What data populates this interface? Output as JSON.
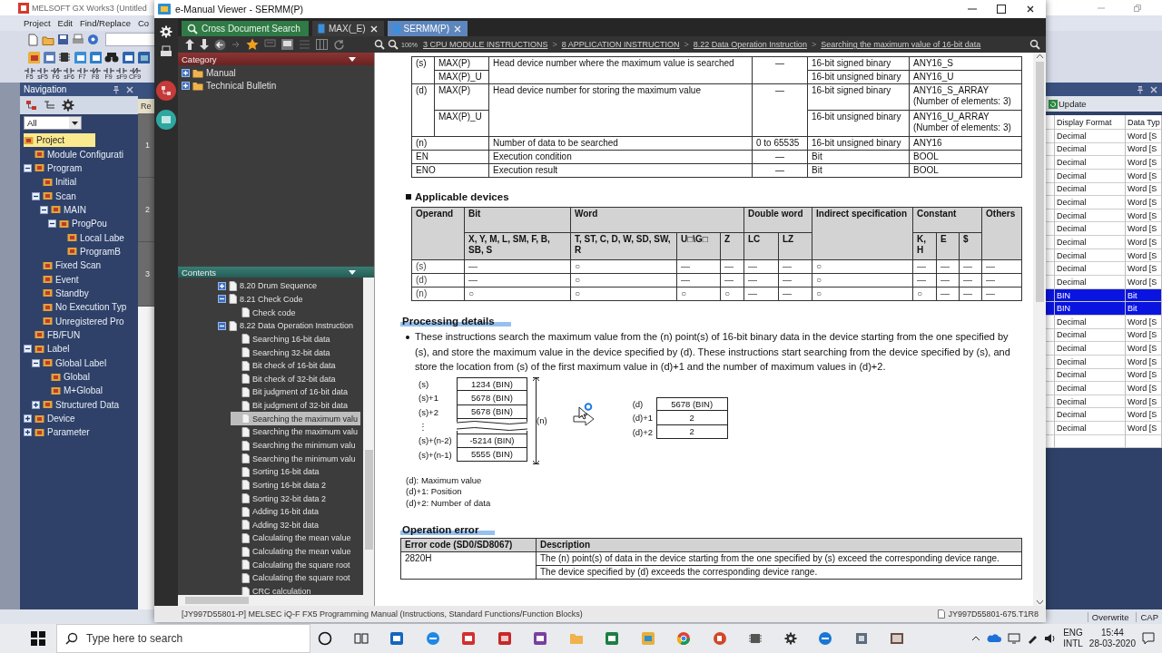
{
  "back_window": {
    "title": "MELSOFT GX Works3 (Untitled",
    "menu": [
      "Project",
      "Edit",
      "Find/Replace",
      "Co"
    ],
    "ladder_keys": [
      "F5",
      "sF5",
      "F6",
      "sF6",
      "F7",
      "F8",
      "F9",
      "sF9",
      "CF9"
    ],
    "navigation": {
      "title": "Navigation",
      "filter": "All",
      "tree": [
        {
          "label": "Project",
          "selected": true,
          "children": [
            {
              "label": "Module Configurati",
              "selected": false
            },
            {
              "label": "Program",
              "selected": false,
              "expanded": true,
              "children": [
                {
                  "label": "Initial",
                  "selected": false
                },
                {
                  "label": "Scan",
                  "selected": false,
                  "expanded": true,
                  "children": [
                    {
                      "label": "MAIN",
                      "selected": false,
                      "expanded": true,
                      "children": [
                        {
                          "label": "ProgPou",
                          "selected": false,
                          "expanded": true,
                          "children": [
                            {
                              "label": "Local Labe",
                              "selected": false
                            },
                            {
                              "label": "ProgramB",
                              "selected": false
                            }
                          ]
                        }
                      ]
                    }
                  ]
                },
                {
                  "label": "Fixed Scan",
                  "selected": false
                },
                {
                  "label": "Event",
                  "selected": false
                },
                {
                  "label": "Standby",
                  "selected": false
                },
                {
                  "label": "No Execution Typ",
                  "selected": false
                },
                {
                  "label": "Unregistered Pro",
                  "selected": false
                }
              ]
            },
            {
              "label": "FB/FUN",
              "selected": false
            },
            {
              "label": "Label",
              "selected": false,
              "expanded": true,
              "children": [
                {
                  "label": "Global Label",
                  "selected": false,
                  "expanded": true,
                  "children": [
                    {
                      "label": "Global",
                      "selected": false
                    },
                    {
                      "label": "M+Global",
                      "selected": false
                    }
                  ]
                },
                {
                  "label": "Structured Data",
                  "selected": false,
                  "expanded": false
                }
              ]
            },
            {
              "label": "Device",
              "selected": false,
              "expanded": false
            },
            {
              "label": "Parameter",
              "selected": false,
              "expanded": false
            }
          ]
        }
      ]
    },
    "editor": {
      "tab": "Re",
      "line_numbers": [
        "1",
        "2",
        "3"
      ]
    },
    "watch": {
      "toolbar_button": "Update",
      "columns": [
        "Display Format",
        "Data Typ"
      ],
      "rows": [
        {
          "display_format": "Decimal",
          "data_type": "Word [S",
          "selected": false
        },
        {
          "display_format": "Decimal",
          "data_type": "Word [S",
          "selected": false
        },
        {
          "display_format": "Decimal",
          "data_type": "Word [S",
          "selected": false
        },
        {
          "display_format": "Decimal",
          "data_type": "Word [S",
          "selected": false
        },
        {
          "display_format": "Decimal",
          "data_type": "Word [S",
          "selected": false
        },
        {
          "display_format": "Decimal",
          "data_type": "Word [S",
          "selected": false
        },
        {
          "display_format": "Decimal",
          "data_type": "Word [S",
          "selected": false
        },
        {
          "display_format": "Decimal",
          "data_type": "Word [S",
          "selected": false
        },
        {
          "display_format": "Decimal",
          "data_type": "Word [S",
          "selected": false
        },
        {
          "display_format": "Decimal",
          "data_type": "Word [S",
          "selected": false
        },
        {
          "display_format": "Decimal",
          "data_type": "Word [S",
          "selected": false
        },
        {
          "display_format": "Decimal",
          "data_type": "Word [S",
          "selected": false
        },
        {
          "display_format": "BIN",
          "data_type": "Bit",
          "selected": true
        },
        {
          "display_format": "BIN",
          "data_type": "Bit",
          "selected": true
        },
        {
          "display_format": "Decimal",
          "data_type": "Word [S",
          "selected": false
        },
        {
          "display_format": "Decimal",
          "data_type": "Word [S",
          "selected": false
        },
        {
          "display_format": "Decimal",
          "data_type": "Word [S",
          "selected": false
        },
        {
          "display_format": "Decimal",
          "data_type": "Word [S",
          "selected": false
        },
        {
          "display_format": "Decimal",
          "data_type": "Word [S",
          "selected": false
        },
        {
          "display_format": "Decimal",
          "data_type": "Word [S",
          "selected": false
        },
        {
          "display_format": "Decimal",
          "data_type": "Word [S",
          "selected": false
        },
        {
          "display_format": "Decimal",
          "data_type": "Word [S",
          "selected": false
        },
        {
          "display_format": "Decimal",
          "data_type": "Word [S",
          "selected": false
        }
      ]
    },
    "status_bar": [
      "Overwrite",
      "CAP"
    ]
  },
  "manual_viewer": {
    "title": "e-Manual Viewer - SERMM(P)",
    "tabs": [
      {
        "label": "Cross Document Search",
        "kind": "search",
        "selected": false,
        "closable": false
      },
      {
        "label": "MAX(_E)",
        "kind": "document",
        "selected": false,
        "closable": true
      },
      {
        "label": "SERMM(P)",
        "kind": "document",
        "selected": true,
        "closable": true
      }
    ],
    "zoom": "100%",
    "breadcrumb": {
      "separator": ">",
      "items": [
        "3 CPU MODULE INSTRUCTIONS",
        "8 APPLICATION INSTRUCTION",
        "8.22 Data Operation Instruction",
        "Searching the maximum value of 16-bit data"
      ]
    },
    "category": {
      "title": "Category",
      "tree": [
        {
          "label": "Manual",
          "expanded": false
        },
        {
          "label": "Technical Bulletin",
          "expanded": false
        }
      ]
    },
    "contents": {
      "title": "Contents",
      "tree": [
        {
          "label": "8.20 Drum Sequence",
          "expanded": false,
          "selected": false
        },
        {
          "label": "8.21 Check Code",
          "expanded": true,
          "selected": false,
          "children": [
            {
              "label": "Check code",
              "selected": false
            }
          ]
        },
        {
          "label": "8.22 Data Operation Instruction",
          "expanded": true,
          "selected": false,
          "children": [
            {
              "label": "Searching 16-bit data",
              "selected": false
            },
            {
              "label": "Searching 32-bit data",
              "selected": false
            },
            {
              "label": "Bit check of 16-bit data",
              "selected": false
            },
            {
              "label": "Bit check of 32-bit data",
              "selected": false
            },
            {
              "label": "Bit judgment of 16-bit data",
              "selected": false
            },
            {
              "label": "Bit judgment of 32-bit data",
              "selected": false
            },
            {
              "label": "Searching the maximum valu",
              "selected": true
            },
            {
              "label": "Searching the maximum valu",
              "selected": false
            },
            {
              "label": "Searching the minimum valu",
              "selected": false
            },
            {
              "label": "Searching the minimum valu",
              "selected": false
            },
            {
              "label": "Sorting 16-bit data",
              "selected": false
            },
            {
              "label": "Sorting 16-bit data 2",
              "selected": false
            },
            {
              "label": "Sorting 32-bit data 2",
              "selected": false
            },
            {
              "label": "Adding 16-bit data",
              "selected": false
            },
            {
              "label": "Adding 32-bit data",
              "selected": false
            },
            {
              "label": "Calculating the mean value",
              "selected": false
            },
            {
              "label": "Calculating the mean value",
              "selected": false
            },
            {
              "label": "Calculating the square root",
              "selected": false
            },
            {
              "label": "Calculating the square root",
              "selected": false
            },
            {
              "label": "CRC calculation",
              "selected": false
            }
          ]
        }
      ]
    },
    "document": {
      "operand_table": {
        "rows": [
          {
            "operand": "(s)",
            "description": "Head device number where the maximum value is searched",
            "range": "—",
            "variants": [
              {
                "instruction": "MAX(P)",
                "data_type": "16-bit signed binary",
                "label_type": "ANY16_S"
              },
              {
                "instruction": "MAX(P)_U",
                "data_type": "16-bit unsigned binary",
                "label_type": "ANY16_U"
              }
            ]
          },
          {
            "operand": "(d)",
            "description": "Head device number for storing the maximum value",
            "range": "—",
            "variants": [
              {
                "instruction": "MAX(P)",
                "data_type": "16-bit signed binary",
                "label_type": "ANY16_S_ARRAY",
                "label_note": "(Number of elements: 3)"
              },
              {
                "instruction": "MAX(P)_U",
                "data_type": "16-bit unsigned binary",
                "label_type": "ANY16_U_ARRAY",
                "label_note": "(Number of elements: 3)"
              }
            ]
          },
          {
            "operand": "(n)",
            "description": "Number of data to be searched",
            "range": "0 to 65535",
            "variants": [
              {
                "data_type": "16-bit unsigned binary",
                "label_type": "ANY16"
              }
            ]
          },
          {
            "operand": "EN",
            "description": "Execution condition",
            "range": "—",
            "variants": [
              {
                "data_type": "Bit",
                "label_type": "BOOL"
              }
            ]
          },
          {
            "operand": "ENO",
            "description": "Execution result",
            "range": "—",
            "variants": [
              {
                "data_type": "Bit",
                "label_type": "BOOL"
              }
            ]
          }
        ]
      },
      "applicable_devices": {
        "title": "Applicable devices",
        "operand_heading": "Operand",
        "groups": [
          {
            "label": "Bit",
            "columns": [
              "X, Y, M, L, SM, F, B, SB, S"
            ]
          },
          {
            "label": "Word",
            "columns": [
              "T, ST, C, D, W, SD, SW, R",
              "U□\\G□",
              "Z"
            ]
          },
          {
            "label": "Double word",
            "columns": [
              "LC",
              "LZ"
            ]
          },
          {
            "label": "Indirect specification"
          },
          {
            "label": "Constant",
            "columns": [
              "K, H",
              "E",
              "$"
            ]
          },
          {
            "label": "Others"
          }
        ],
        "rows": [
          {
            "operand": "(s)",
            "cells": [
              "—",
              "○",
              "—",
              "—",
              "—",
              "—",
              "○",
              "—",
              "—",
              "—",
              "—"
            ]
          },
          {
            "operand": "(d)",
            "cells": [
              "—",
              "○",
              "—",
              "—",
              "—",
              "—",
              "○",
              "—",
              "—",
              "—",
              "—"
            ]
          },
          {
            "operand": "(n)",
            "cells": [
              "○",
              "○",
              "○",
              "○",
              "—",
              "—",
              "○",
              "○",
              "—",
              "—",
              "—"
            ]
          }
        ]
      },
      "processing": {
        "title": "Processing details",
        "text": "These instructions search the maximum value from the (n) point(s) of 16-bit binary data in the device starting from the one specified by (s), and store the maximum value in the device specified by (d). These instructions start searching from the device specified by (s), and store the location from (s) of the first maximum value in (d)+1 and the number of maximum values in (d)+2.",
        "source": [
          {
            "label": "(s)",
            "value": "1234 (BIN)"
          },
          {
            "label": "(s)+1",
            "value": "5678 (BIN)"
          },
          {
            "label": "(s)+2",
            "value": "5678 (BIN)"
          },
          {
            "label": "⋮",
            "kind": "break"
          },
          {
            "label": "(s)+(n-2)",
            "value": "-5214 (BIN)"
          },
          {
            "label": "(s)+(n-1)",
            "value": "5555 (BIN)"
          }
        ],
        "span_label": "(n)",
        "result": [
          {
            "label": "(d)",
            "value": "5678 (BIN)"
          },
          {
            "label": "(d)+1",
            "value": "2"
          },
          {
            "label": "(d)+2",
            "value": "2"
          }
        ],
        "legend": [
          "(d): Maximum value",
          "(d)+1: Position",
          "(d)+2: Number of data"
        ]
      },
      "operation_error": {
        "title": "Operation error",
        "columns": [
          "Error code (SD0/SD8067)",
          "Description"
        ],
        "rows": [
          {
            "code": "2820H",
            "descriptions": [
              "The (n) point(s) of data in the device starting from the one specified by (s) exceed the corresponding device range.",
              "The device specified by (d) exceeds the corresponding device range."
            ]
          }
        ]
      }
    },
    "status_bar": {
      "manual": "[JY997D55801-P] MELSEC iQ-F FX5 Programming Manual (Instructions, Standard Functions/Function Blocks)",
      "page_id": "JY997D55801-675.T1R8"
    }
  },
  "taskbar": {
    "search_placeholder": "Type here to search",
    "language": "ENG",
    "layout": "INTL",
    "time": "15:44",
    "date": "28-03-2020"
  }
}
